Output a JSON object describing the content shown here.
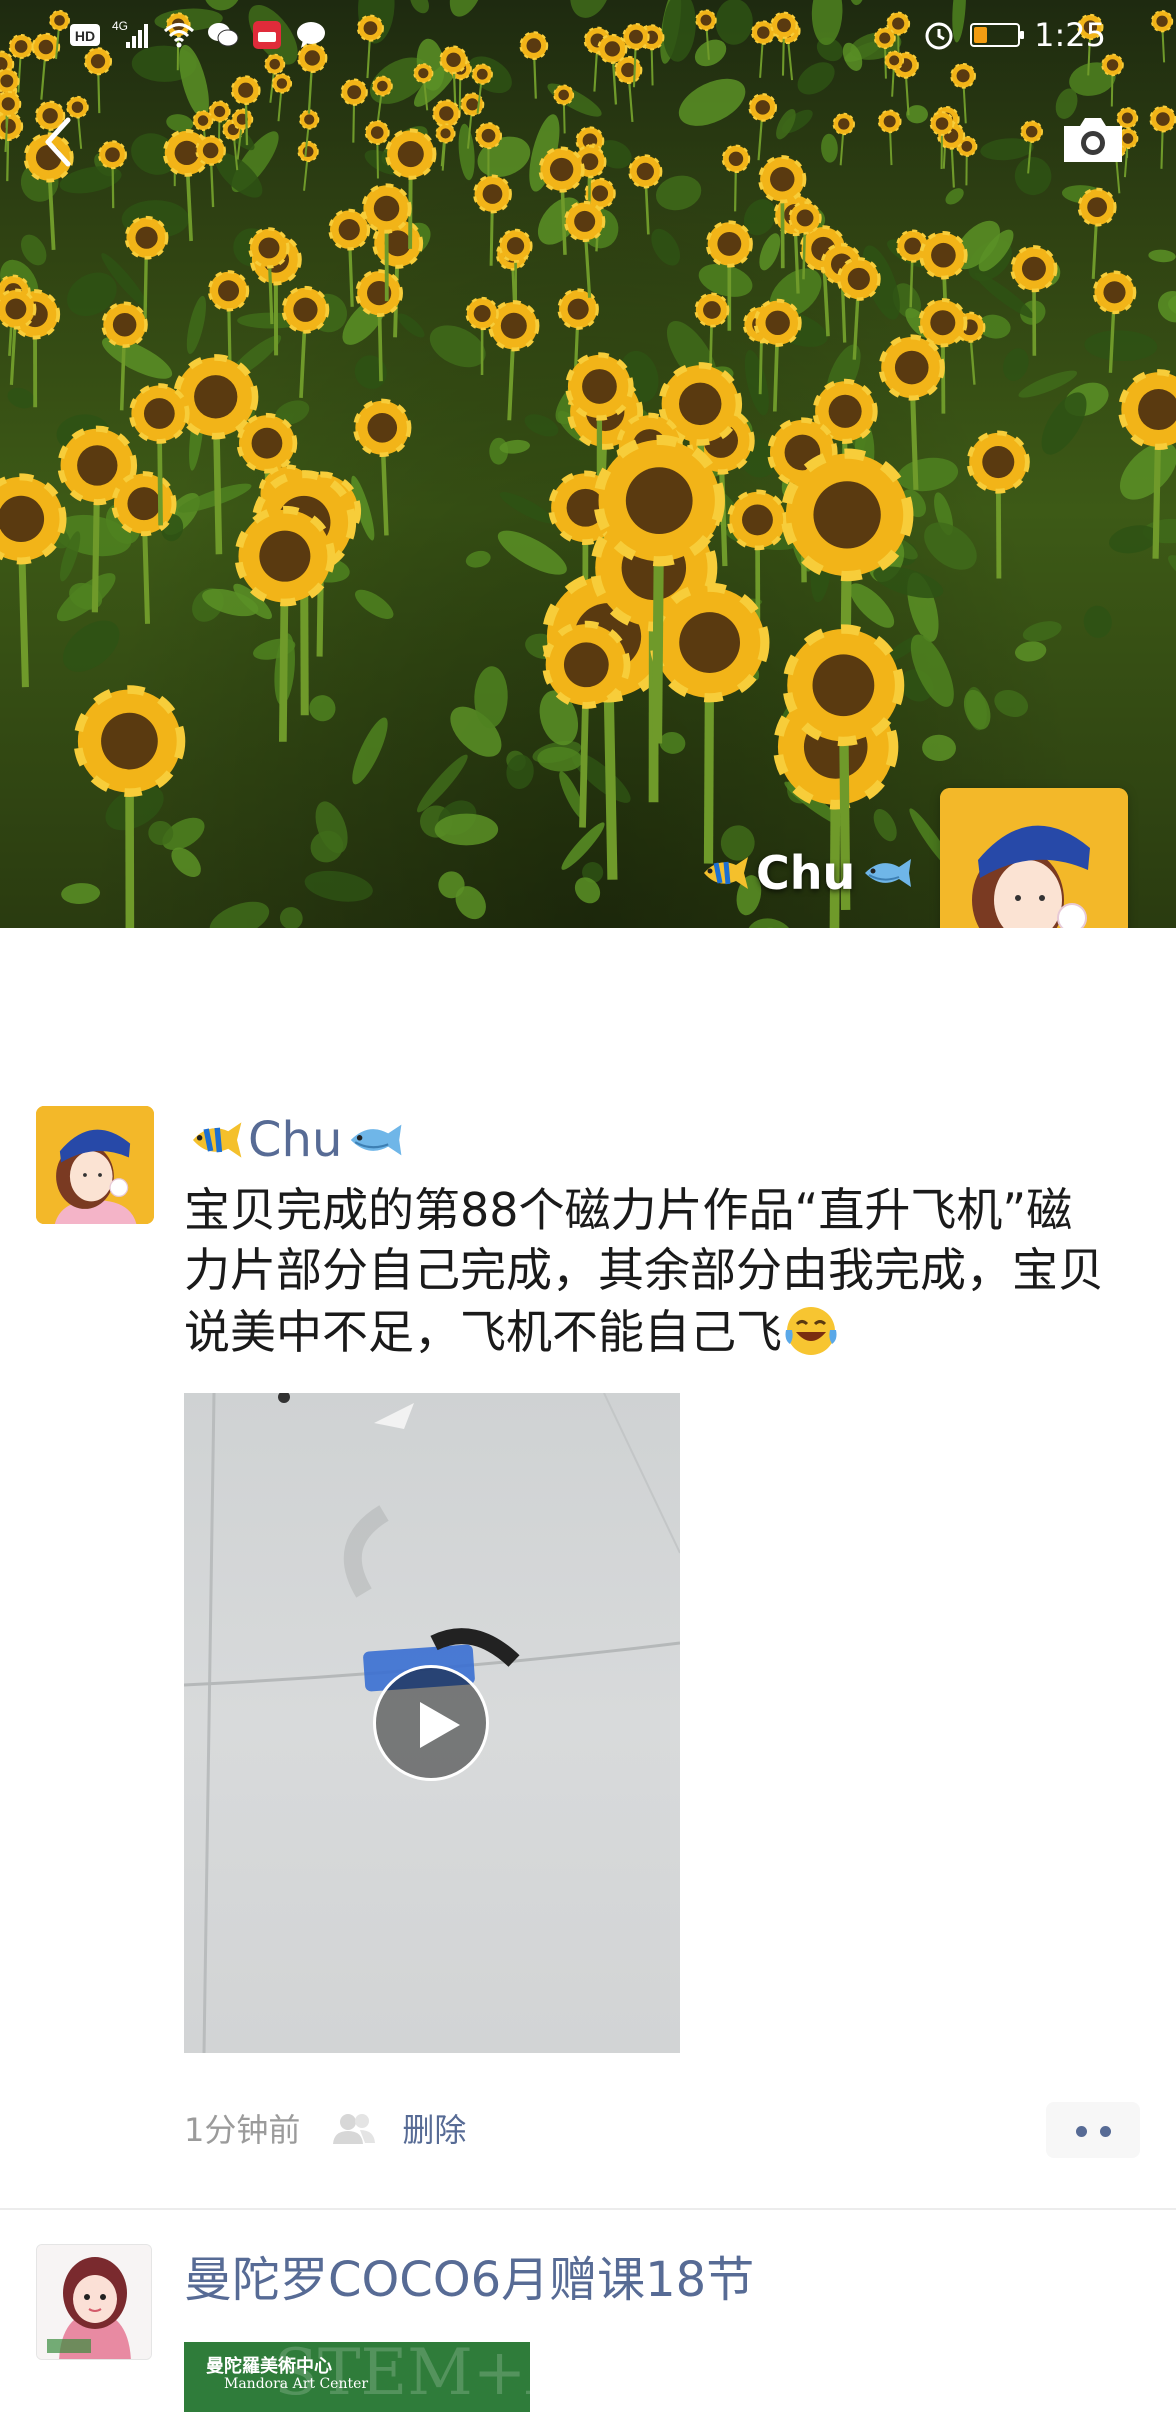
{
  "status_bar": {
    "hd_label": "HD",
    "network_label": "4G",
    "time": "1:25",
    "battery_level": 0.3
  },
  "cover": {
    "user_name": "Chu",
    "left_fish_icon": "tropical-fish-icon",
    "right_fish_icon": "fish-icon",
    "back_icon": "chevron-left-icon",
    "camera_icon": "camera-icon"
  },
  "post": {
    "user_name": "Chu",
    "text": "宝贝完成的第88个磁力片作品“直升飞机”磁力片部分自己完成，其余部分由我完成，宝贝说美中不足，飞机不能自己飞",
    "text_emoji": "crying-laughing-emoji",
    "video_icon": "play-icon",
    "time_ago": "1分钟前",
    "privacy_icon": "people-icon",
    "delete_label": "删除",
    "more_icon": "more-dots-icon"
  },
  "next_post": {
    "title": "曼陀罗COCO6月赠课18节",
    "image_title": "曼陀羅美術中心",
    "image_subtitle": "Mandora Art Center",
    "image_ghost_text": "STEM+A"
  },
  "colors": {
    "link_blue": "#576b95",
    "meta_gray": "#9b9b9b",
    "avatar_yellow": "#f3b829"
  }
}
